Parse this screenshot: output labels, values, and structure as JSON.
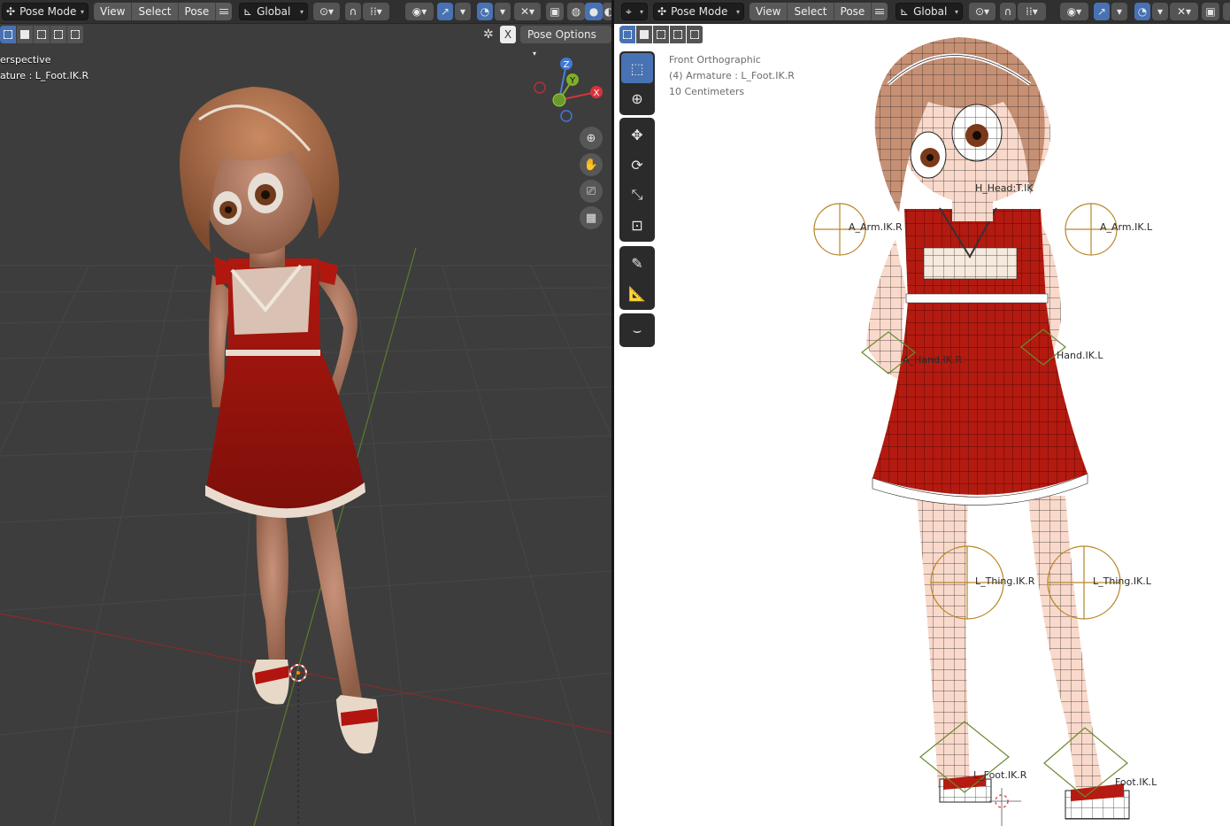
{
  "left_view": {
    "mode_label": "Pose Mode",
    "menus": [
      "View",
      "Select",
      "Pose"
    ],
    "orientation": "Global",
    "pose_options_label": "Pose Options",
    "x_label": "X",
    "view_name": "erspective",
    "active_object": "ature : L_Foot.IK.R",
    "gizmo_axes": {
      "x": "X",
      "y": "Y",
      "z": "Z"
    }
  },
  "right_view": {
    "mode_label": "Pose Mode",
    "menus": [
      "View",
      "Select",
      "Pose"
    ],
    "orientation": "Global",
    "view_name": "Front Orthographic",
    "active_object": "(4) Armature : L_Foot.IK.R",
    "scale_text": "10 Centimeters",
    "bone_labels": {
      "head": "H_Head:T.IK",
      "arm_r": "A_Arm.IK.R",
      "arm_l": "A_Arm.IK.L",
      "hand_r": "A_Hand.IK.R",
      "hand_l": "Hand.IK.L",
      "thigh_r": "L_Thing.IK.R",
      "thigh_l": "L_Thing.IK.L",
      "foot_r": "L_Foot.IK.R",
      "foot_l": "Foot.IK.L"
    }
  },
  "colors": {
    "accent": "#4772b3",
    "dress": "#a3150f",
    "skin": "#b0795d",
    "hair": "#9c5e3c",
    "bone_circle": "#b8862a",
    "bone_diamond": "#6a8a2e"
  }
}
